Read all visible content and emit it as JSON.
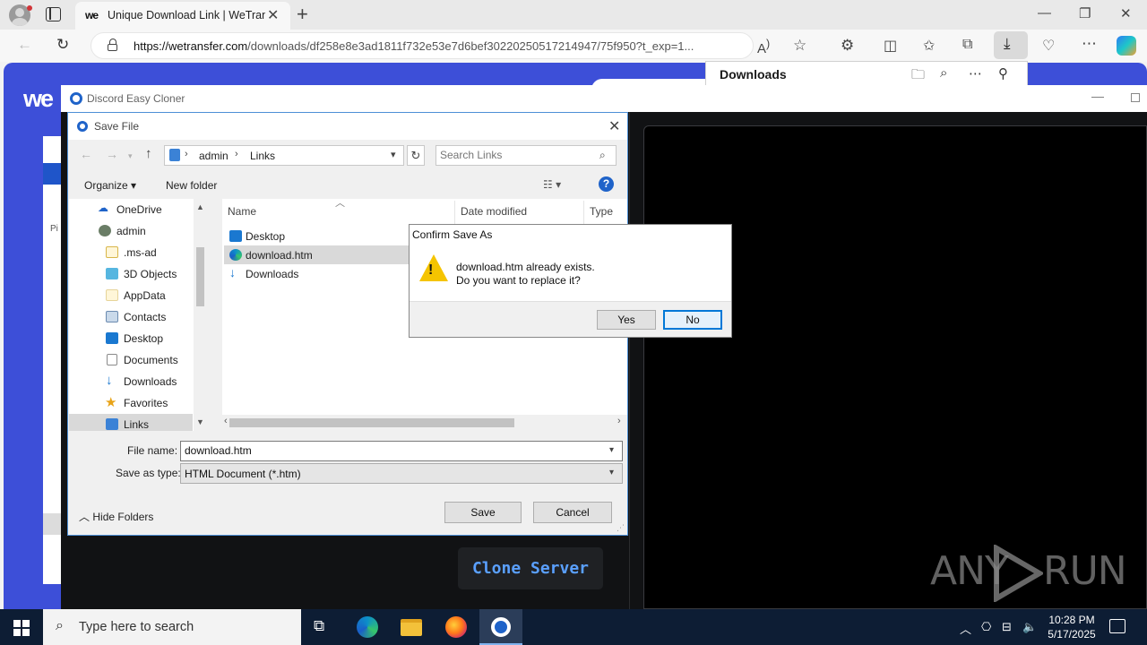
{
  "browser": {
    "tab_title": "Unique Download Link | WeTransfer",
    "tab_favicon": "we",
    "url_domain": "https://wetransfer.com",
    "url_path": "/downloads/df258e8e3ad1811f732e53e7d6bef30220250517214947/75f950?t_exp=1...",
    "icons": [
      "profile-icon",
      "workspaces-icon",
      "close-icon",
      "new-tab-icon",
      "back-icon",
      "refresh-icon",
      "lock-icon",
      "read-aloud-icon",
      "favorite-icon",
      "extensions-icon",
      "split-screen-icon",
      "favorites-icon",
      "collections-icon",
      "downloads-icon",
      "browser-essentials-icon",
      "more-icon",
      "copilot-icon"
    ]
  },
  "downloads_flyout": {
    "title": "Downloads"
  },
  "wetransfer": {
    "logo": "we",
    "brand_color": "#3d4fd8",
    "side_text": "Pi"
  },
  "app": {
    "title": "Discord Easy Cloner",
    "clone_button": "Clone Server",
    "clone_color": "#5aa0ff"
  },
  "save_dialog": {
    "title": "Save File",
    "breadcrumb": [
      "admin",
      "Links"
    ],
    "search_placeholder": "Search Links",
    "organize": "Organize",
    "new_folder": "New folder",
    "help": "?",
    "nav_items": [
      {
        "label": "OneDrive",
        "icon": "onedrive-icon"
      },
      {
        "label": "admin",
        "icon": "user-icon"
      },
      {
        "label": ".ms-ad",
        "icon": "folder-icon"
      },
      {
        "label": "3D Objects",
        "icon": "3d-objects-icon"
      },
      {
        "label": "AppData",
        "icon": "folder-icon"
      },
      {
        "label": "Contacts",
        "icon": "contacts-icon"
      },
      {
        "label": "Desktop",
        "icon": "desktop-icon"
      },
      {
        "label": "Documents",
        "icon": "documents-icon"
      },
      {
        "label": "Downloads",
        "icon": "downloads-icon"
      },
      {
        "label": "Favorites",
        "icon": "favorites-icon"
      },
      {
        "label": "Links",
        "icon": "links-icon"
      }
    ],
    "columns": {
      "name": "Name",
      "date": "Date modified",
      "type": "Type"
    },
    "files": [
      {
        "name": "Desktop",
        "icon": "desktop-icon"
      },
      {
        "name": "download.htm",
        "icon": "edge-icon"
      },
      {
        "name": "Downloads",
        "icon": "downloads-icon"
      }
    ],
    "file_name_label": "File name:",
    "file_name_value": "download.htm",
    "save_as_type_label": "Save as type:",
    "save_as_type_value": "HTML Document (*.htm)",
    "hide_folders": "Hide Folders",
    "save_button": "Save",
    "cancel_button": "Cancel"
  },
  "confirm_dialog": {
    "title": "Confirm Save As",
    "line1": "download.htm already exists.",
    "line2": "Do you want to replace it?",
    "yes": "Yes",
    "no": "No",
    "warning_color": "#f5c400"
  },
  "watermark": {
    "left": "ANY",
    "right": "RUN"
  },
  "taskbar": {
    "search_placeholder": "Type here to search",
    "time": "10:28 PM",
    "date": "5/17/2025",
    "pinned": [
      "task-view-icon",
      "edge-icon",
      "file-explorer-icon",
      "firefox-icon",
      "discord-cloner-icon"
    ]
  }
}
